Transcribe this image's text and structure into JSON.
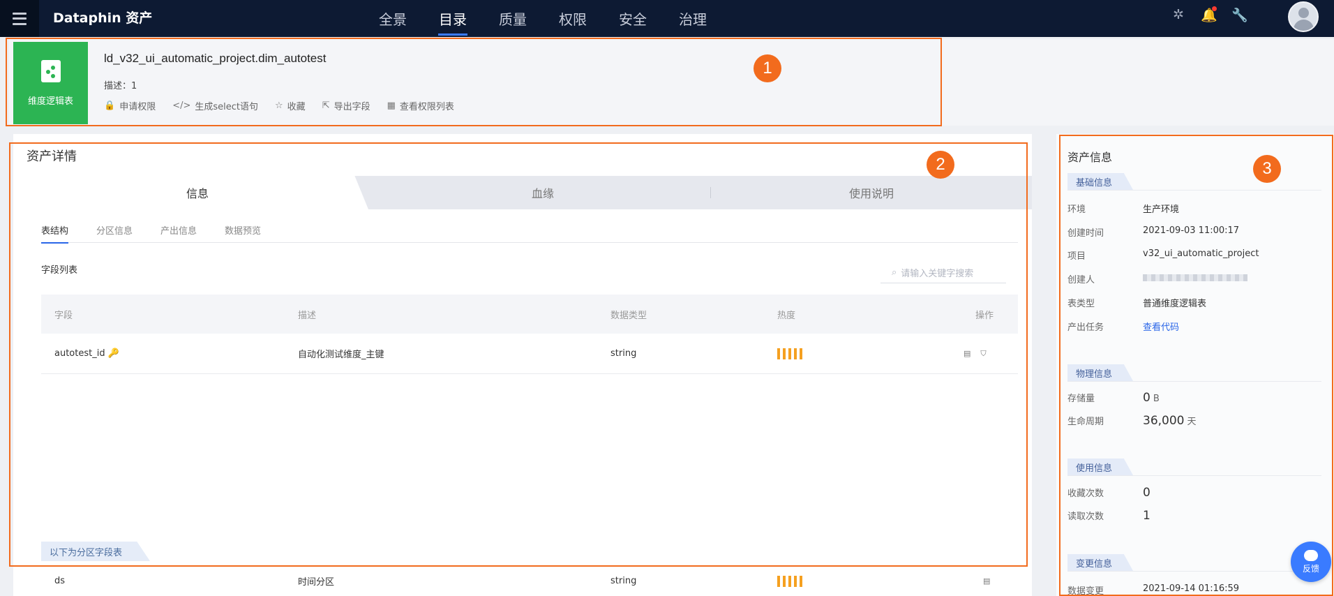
{
  "app": {
    "logo": "Dataphin 资产"
  },
  "nav": {
    "items": [
      "全景",
      "目录",
      "质量",
      "权限",
      "安全",
      "治理"
    ],
    "active": "目录"
  },
  "header": {
    "type_label": "维度逻辑表",
    "table_name": "ld_v32_ui_automatic_project.dim_autotest",
    "desc_label": "描述：",
    "desc_value": "1",
    "actions": [
      "申请权限",
      "生成select语句",
      "收藏",
      "导出字段",
      "查看权限列表"
    ]
  },
  "detail": {
    "title": "资产详情",
    "tabs": [
      "信息",
      "血缘",
      "使用说明"
    ],
    "subtabs": [
      "表结构",
      "分区信息",
      "产出信息",
      "数据预览"
    ],
    "field_list_title": "字段列表",
    "search_placeholder": "请输入关键字搜索",
    "columns": [
      "字段",
      "描述",
      "数据类型",
      "热度",
      "操作"
    ],
    "rows": [
      {
        "field": "autotest_id",
        "desc": "自动化测试维度_主键",
        "type": "string"
      }
    ],
    "partition_label": "以下为分区字段表",
    "partition_rows": [
      {
        "field": "ds",
        "desc": "时间分区",
        "type": "string"
      }
    ]
  },
  "info": {
    "title": "资产信息",
    "basic": {
      "label": "基础信息",
      "items": [
        {
          "k": "环境",
          "v": "生产环境"
        },
        {
          "k": "创建时间",
          "v": "2021-09-03 11:00:17"
        },
        {
          "k": "项目",
          "v": "v32_ui_automatic_project"
        },
        {
          "k": "创建人",
          "v": ""
        },
        {
          "k": "表类型",
          "v": "普通维度逻辑表"
        },
        {
          "k": "产出任务",
          "v": "查看代码"
        }
      ]
    },
    "physical": {
      "label": "物理信息",
      "storage_k": "存储量",
      "storage_v": "0",
      "storage_unit": "B",
      "lifecycle_k": "生命周期",
      "lifecycle_v": "36,000",
      "lifecycle_unit": "天"
    },
    "usage": {
      "label": "使用信息",
      "fav_k": "收藏次数",
      "fav_v": "0",
      "read_k": "读取次数",
      "read_v": "1"
    },
    "change": {
      "label": "变更信息",
      "k": "数据变更",
      "v": "2021-09-14 01:16:59"
    }
  },
  "feedback": {
    "label": "反馈"
  },
  "annotations": [
    "1",
    "2",
    "3"
  ]
}
